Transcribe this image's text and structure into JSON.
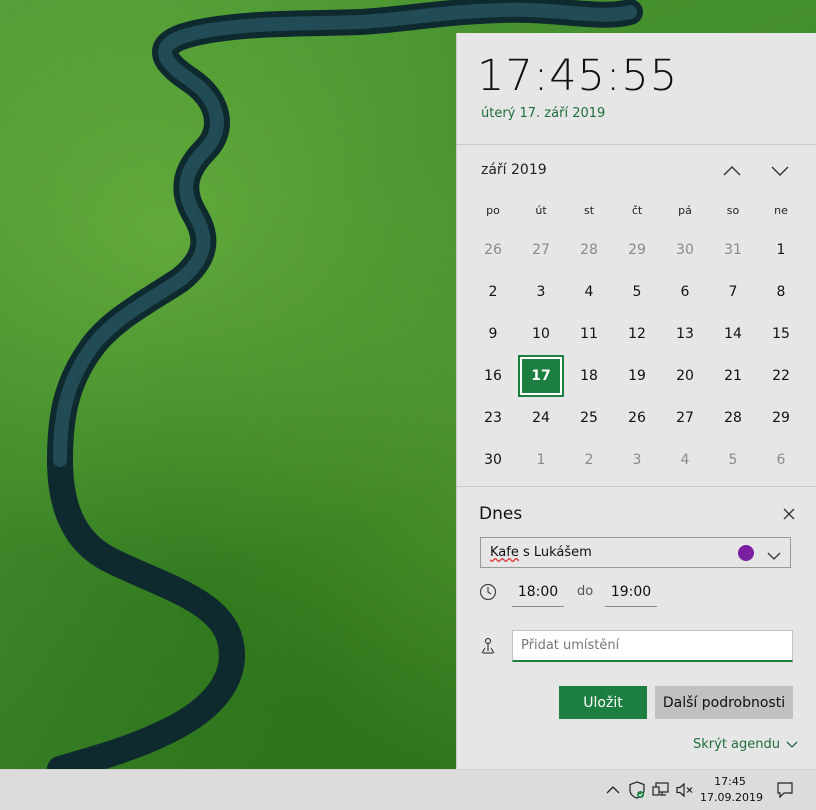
{
  "clock": {
    "time": "17:45:55",
    "date_long": "úterý 17. září 2019"
  },
  "calendar": {
    "month_label": "září 2019",
    "weekdays": [
      "po",
      "út",
      "st",
      "čt",
      "pá",
      "so",
      "ne"
    ],
    "weeks": [
      [
        {
          "d": "26",
          "other": true
        },
        {
          "d": "27",
          "other": true
        },
        {
          "d": "28",
          "other": true
        },
        {
          "d": "29",
          "other": true
        },
        {
          "d": "30",
          "other": true
        },
        {
          "d": "31",
          "other": true
        },
        {
          "d": "1"
        }
      ],
      [
        {
          "d": "2"
        },
        {
          "d": "3"
        },
        {
          "d": "4"
        },
        {
          "d": "5"
        },
        {
          "d": "6"
        },
        {
          "d": "7"
        },
        {
          "d": "8"
        }
      ],
      [
        {
          "d": "9"
        },
        {
          "d": "10"
        },
        {
          "d": "11"
        },
        {
          "d": "12"
        },
        {
          "d": "13"
        },
        {
          "d": "14"
        },
        {
          "d": "15"
        }
      ],
      [
        {
          "d": "16"
        },
        {
          "d": "17",
          "today": true
        },
        {
          "d": "18"
        },
        {
          "d": "19"
        },
        {
          "d": "20"
        },
        {
          "d": "21"
        },
        {
          "d": "22"
        }
      ],
      [
        {
          "d": "23"
        },
        {
          "d": "24"
        },
        {
          "d": "25"
        },
        {
          "d": "26"
        },
        {
          "d": "27"
        },
        {
          "d": "28"
        },
        {
          "d": "29"
        }
      ],
      [
        {
          "d": "30"
        },
        {
          "d": "1",
          "other": true
        },
        {
          "d": "2",
          "other": true
        },
        {
          "d": "3",
          "other": true
        },
        {
          "d": "4",
          "other": true
        },
        {
          "d": "5",
          "other": true
        },
        {
          "d": "6",
          "other": true
        }
      ]
    ],
    "today_color": "#1c7f3f"
  },
  "agenda": {
    "title": "Dnes",
    "event_name_squiggle": "Kafe",
    "event_name_rest": " s Lukášem",
    "event_color": "#7b1fa2",
    "start_time": "18:00",
    "to_label": "do",
    "end_time": "19:00",
    "location_placeholder": "Přidat umístění",
    "save_label": "Uložit",
    "more_label": "Další podrobnosti",
    "hide_label": "Skrýt agendu"
  },
  "taskbar": {
    "time": "17:45",
    "date": "17.09.2019"
  },
  "accent_color": "#1c7f3f"
}
